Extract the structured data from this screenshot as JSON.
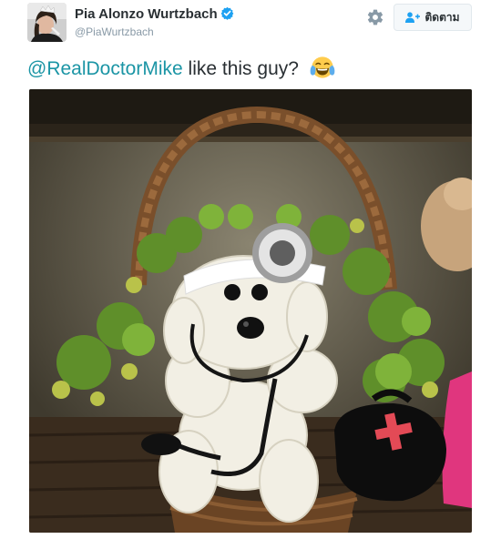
{
  "user": {
    "display_name": "Pia Alonzo Wurtzbach",
    "handle": "@PiaWurtzbach",
    "verified_icon": "verified-badge-icon",
    "avatar_icon": "profile-photo"
  },
  "actions": {
    "settings_icon": "gear-icon",
    "follow_icon": "add-user-icon",
    "follow_label": "ติดตาม"
  },
  "tweet": {
    "mention": "@RealDoctorMike",
    "text": " like this guy?",
    "emoji_icon": "face-with-tears-of-joy-emoji"
  },
  "media": {
    "image_icon": "flower-dog-doctor-basket-photo"
  },
  "colors": {
    "mention": "#1b95a5",
    "verified": "#1da1f2",
    "name_text": "#292f33",
    "secondary_text": "#8899a6",
    "button_bg": "#f5f8fa",
    "button_border": "#e1e8ed"
  }
}
